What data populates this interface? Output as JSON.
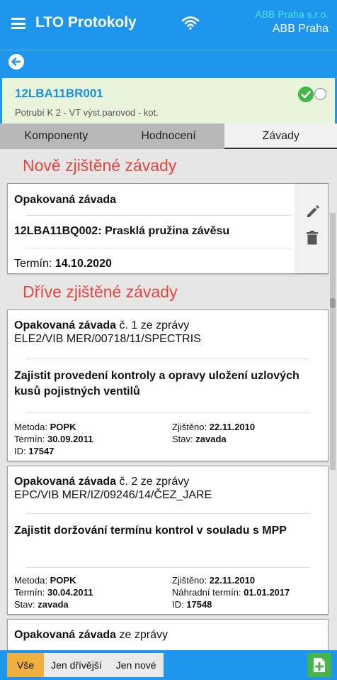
{
  "header": {
    "title": "LTO Protokoly",
    "company_line1": "ABB Praha s.r.o.",
    "company_line2": "ABB Praha"
  },
  "component": {
    "code": "12LBA11BR001",
    "description": "Potrubí K 2 - VT výst.parovod - kot."
  },
  "tabs": [
    {
      "label": "Komponenty",
      "active": false
    },
    {
      "label": "Hodnocení",
      "active": false
    },
    {
      "label": "Závady",
      "active": true
    }
  ],
  "sections": {
    "new_title": "Nově zjištěné závady",
    "old_title": "Dříve zjištěné závady"
  },
  "new_defect": {
    "type": "Opakovaná závada",
    "name": "12LBA11BQ002: Prasklá pružina závěsu",
    "term_label": "Termín:",
    "term_value": "14.10.2020"
  },
  "old_defects": [
    {
      "type": "Opakovaná závada",
      "ref_prefix": " č. 1 ze zprávy",
      "ref": "ELE2/VIB MER/00718/11/SPECTRIS",
      "task": "Zajistit provedení kontroly a opravy uložení uzlových kusů pojistných ventilů",
      "method_label": "Metoda:",
      "method": "POPK",
      "term_label": "Termín:",
      "term": "30.09.2011",
      "id_label": "ID:",
      "id": "17547",
      "found_label": "Zjištěno:",
      "found": "22.11.2010",
      "state_label": "Stav:",
      "state": "zavada"
    },
    {
      "type": "Opakovaná závada",
      "ref_prefix": " č. 2 ze zprávy",
      "ref": "EPC/VIB MER/IZ/09246/14/ČEZ_JARE",
      "task": "Zajistit doržování termínu kontrol v souladu s MPP",
      "method_label": "Metoda:",
      "method": "POPK",
      "term_label": "Termín:",
      "term": "30.04.2011",
      "state_label": "Stav:",
      "state": "zavada",
      "found_label": "Zjištěno:",
      "found": "22.11.2010",
      "alt_term_label": "Náhradní termín:",
      "alt_term": "01.01.2017",
      "id_label": "ID:",
      "id": "17548"
    },
    {
      "type": "Opakovaná závada",
      "ref_prefix": " ze zprávy"
    }
  ],
  "filters": [
    {
      "label": "Vše",
      "active": true
    },
    {
      "label": "Jen dřívější",
      "active": false
    },
    {
      "label": "Jen nové",
      "active": false
    }
  ],
  "colors": {
    "primary": "#1e96ee",
    "section_title": "#e8443e",
    "success": "#45b649",
    "filter_active": "#f0b040"
  },
  "icons": [
    "menu-icon",
    "wifi-icon",
    "back-arrow-icon",
    "check-circle-icon",
    "radio-icon",
    "edit-icon",
    "delete-icon",
    "add-document-icon"
  ]
}
